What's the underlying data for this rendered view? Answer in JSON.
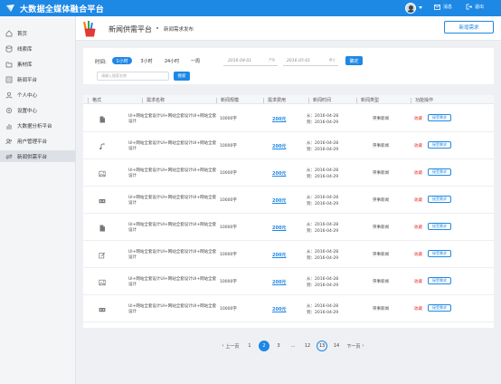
{
  "app": {
    "title": "大数据全媒体融合平台",
    "top_actions": {
      "message_label": "消息",
      "exit_label": "退出"
    }
  },
  "sidebar": {
    "items": [
      {
        "label": "首页",
        "icon": "home-icon"
      },
      {
        "label": "线索库",
        "icon": "database-icon"
      },
      {
        "label": "素材库",
        "icon": "folder-icon"
      },
      {
        "label": "新闻平台",
        "icon": "news-icon"
      },
      {
        "label": "个人中心",
        "icon": "user-icon"
      },
      {
        "label": "设置中心",
        "icon": "gear-icon"
      },
      {
        "label": "大数据分析平台",
        "icon": "analytics-icon"
      },
      {
        "label": "用户管理平台",
        "icon": "users-icon"
      },
      {
        "label": "新闻供需平台",
        "icon": "exchange-icon",
        "active": true
      }
    ]
  },
  "header": {
    "title": "新闻供需平台",
    "breadcrumb": "新闻需求发布",
    "new_button": "新增需求"
  },
  "filter": {
    "time_label": "时间:",
    "ranges": [
      "1小时",
      "3小时",
      "24小时",
      "一周"
    ],
    "active_range": "1小时",
    "date_from": "2016-04-01",
    "date_from_hint": "开始",
    "date_to": "2016-05-01",
    "date_to_hint": "截止",
    "confirm_label": "确定",
    "search_placeholder": "请输入搜索名称",
    "search_button": "搜索"
  },
  "table": {
    "columns": [
      "格式",
      "需求名称",
      "新闻规模",
      "需求费用",
      "新闻时间",
      "新闻类型",
      "功能操作"
    ],
    "rows": [
      {
        "format_icon": "document-icon",
        "name": "UI+网站全套设计UI+网站全套设计UI+网站全套设计",
        "size": "10000字",
        "fee": "200元",
        "from": "从：2016-04-28",
        "to": "到：2016-04-29",
        "type": "突事新闻",
        "collect": "收藏",
        "action": "接受需求"
      },
      {
        "format_icon": "music-icon",
        "name": "UI+网站全套设计UI+网站全套设计UI+网站全套设计",
        "size": "10000字",
        "fee": "200元",
        "from": "从：2016-04-28",
        "to": "到：2016-04-29",
        "type": "突事新闻",
        "collect": "收藏",
        "action": "接受需求"
      },
      {
        "format_icon": "image-icon",
        "name": "UI+网站全套设计UI+网站全套设计UI+网站全套设计",
        "size": "10000字",
        "fee": "200元",
        "from": "从：2016-04-28",
        "to": "到：2016-04-29",
        "type": "突事新闻",
        "collect": "收藏",
        "action": "接受需求"
      },
      {
        "format_icon": "video-icon",
        "name": "UI+网站全套设计UI+网站全套设计UI+网站全套设计",
        "size": "10000字",
        "fee": "200元",
        "from": "从：2016-04-28",
        "to": "到：2016-04-29",
        "type": "突事新闻",
        "collect": "收藏",
        "action": "接受需求"
      },
      {
        "format_icon": "document-icon",
        "name": "UI+网站全套设计UI+网站全套设计UI+网站全套设计",
        "size": "10000字",
        "fee": "200元",
        "from": "从：2016-04-28",
        "to": "到：2016-04-29",
        "type": "突事新闻",
        "collect": "收藏",
        "action": "接受需求"
      },
      {
        "format_icon": "edit-icon",
        "name": "UI+网站全套设计UI+网站全套设计UI+网站全套设计",
        "size": "10000字",
        "fee": "200元",
        "from": "从：2016-04-28",
        "to": "到：2016-04-29",
        "type": "突事新闻",
        "collect": "收藏",
        "action": "接受需求"
      },
      {
        "format_icon": "image-icon",
        "name": "UI+网站全套设计UI+网站全套设计UI+网站全套设计",
        "size": "10000字",
        "fee": "200元",
        "from": "从：2016-04-28",
        "to": "到：2016-04-29",
        "type": "突事新闻",
        "collect": "收藏",
        "action": "接受需求"
      },
      {
        "format_icon": "video-icon",
        "name": "UI+网站全套设计UI+网站全套设计UI+网站全套设计",
        "size": "10000字",
        "fee": "200元",
        "from": "从：2016-04-28",
        "to": "到：2016-04-29",
        "type": "突事新闻",
        "collect": "收藏",
        "action": "接受需求"
      }
    ]
  },
  "pagination": {
    "prev": "上一页",
    "pages": [
      "1",
      "2",
      "3",
      "...",
      "12",
      "13",
      "14"
    ],
    "current": "2",
    "next": "下一页"
  },
  "colors": {
    "primary": "#1e88e5",
    "danger": "#e53935",
    "sidebar_bg": "#f4f5f7",
    "page_bg": "#eef0f4"
  }
}
